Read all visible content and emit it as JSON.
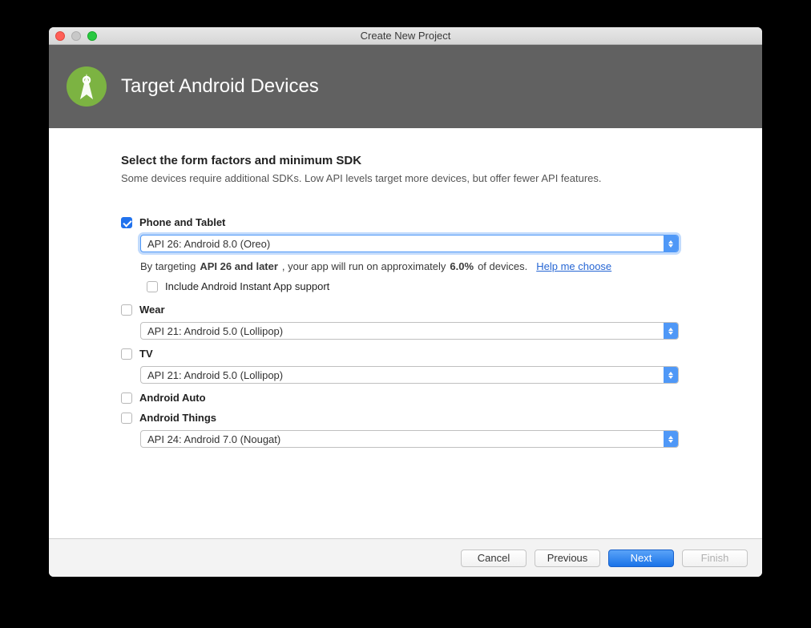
{
  "window": {
    "title": "Create New Project"
  },
  "header": {
    "title": "Target Android Devices"
  },
  "section": {
    "title": "Select the form factors and minimum SDK",
    "description": "Some devices require additional SDKs. Low API levels target more devices, but offer fewer API features."
  },
  "formFactors": {
    "phoneTablet": {
      "label": "Phone and Tablet",
      "checked": true,
      "select": "API 26: Android 8.0 (Oreo)",
      "info_prefix": "By targeting",
      "info_bold1": "API 26 and later",
      "info_mid": ", your app will run on approximately",
      "info_bold2": "6.0%",
      "info_suffix": "of devices.",
      "help_link": "Help me choose",
      "instant_label": "Include Android Instant App support",
      "instant_checked": false
    },
    "wear": {
      "label": "Wear",
      "checked": false,
      "select": "API 21: Android 5.0 (Lollipop)"
    },
    "tv": {
      "label": "TV",
      "checked": false,
      "select": "API 21: Android 5.0 (Lollipop)"
    },
    "auto": {
      "label": "Android Auto",
      "checked": false
    },
    "things": {
      "label": "Android Things",
      "checked": false,
      "select": "API 24: Android 7.0 (Nougat)"
    }
  },
  "footer": {
    "cancel": "Cancel",
    "previous": "Previous",
    "next": "Next",
    "finish": "Finish"
  }
}
